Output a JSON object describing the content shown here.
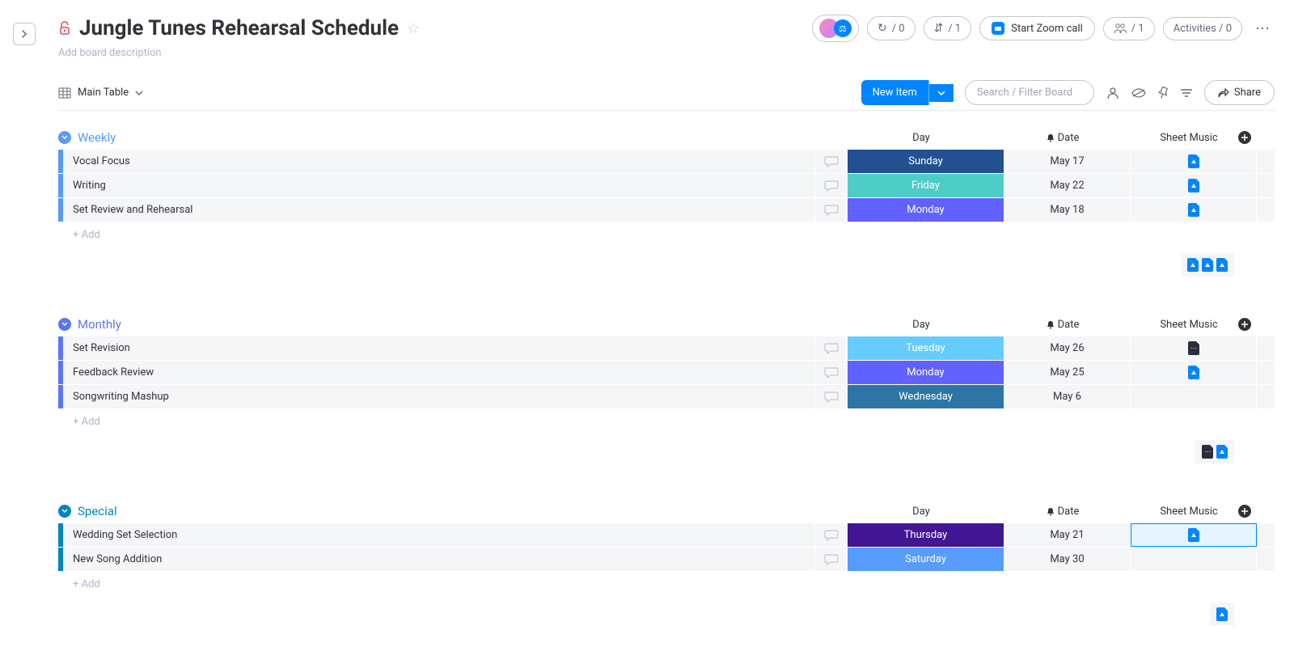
{
  "title": "Jungle Tunes Rehearsal Schedule",
  "description_placeholder": "Add board description",
  "header": {
    "automations_count": "/ 0",
    "integrations_count": "/ 1",
    "zoom_label": "Start Zoom call",
    "members_count": "/ 1",
    "activities_label": "Activities / 0"
  },
  "toolbar": {
    "view_name": "Main Table",
    "new_item_label": "New Item",
    "search_placeholder": "Search / Filter Board",
    "share_label": "Share"
  },
  "columns": {
    "day": "Day",
    "date": "Date",
    "sheet": "Sheet Music"
  },
  "add_row_label": "+ Add",
  "groups": [
    {
      "name": "Weekly",
      "color": "#579bfc",
      "rows": [
        {
          "name": "Vocal Focus",
          "day": "Sunday",
          "day_color": "#225091",
          "date": "May 17",
          "file": "blue"
        },
        {
          "name": "Writing",
          "day": "Friday",
          "day_color": "#4eccc6",
          "date": "May 22",
          "file": "blue"
        },
        {
          "name": "Set Review and Rehearsal",
          "day": "Monday",
          "day_color": "#6161ff",
          "date": "May 18",
          "file": "blue"
        }
      ],
      "footer_files": [
        "blue",
        "blue",
        "blue"
      ]
    },
    {
      "name": "Monthly",
      "color": "#5b76f7",
      "rows": [
        {
          "name": "Set Revision",
          "day": "Tuesday",
          "day_color": "#66ccff",
          "date": "May 26",
          "file": "dark"
        },
        {
          "name": "Feedback Review",
          "day": "Monday",
          "day_color": "#6161ff",
          "date": "May 25",
          "file": "blue"
        },
        {
          "name": "Songwriting Mashup",
          "day": "Wednesday",
          "day_color": "#2b76a5",
          "date": "May 6",
          "file": null
        }
      ],
      "footer_files": [
        "dark",
        "blue"
      ]
    },
    {
      "name": "Special",
      "color": "#0086c0",
      "rows": [
        {
          "name": "Wedding Set Selection",
          "day": "Thursday",
          "day_color": "#401694",
          "date": "May 21",
          "file": "blue",
          "file_selected": true
        },
        {
          "name": "New Song Addition",
          "day": "Saturday",
          "day_color": "#579bfc",
          "date": "May 30",
          "file": null
        }
      ],
      "footer_files": [
        "blue"
      ]
    }
  ]
}
